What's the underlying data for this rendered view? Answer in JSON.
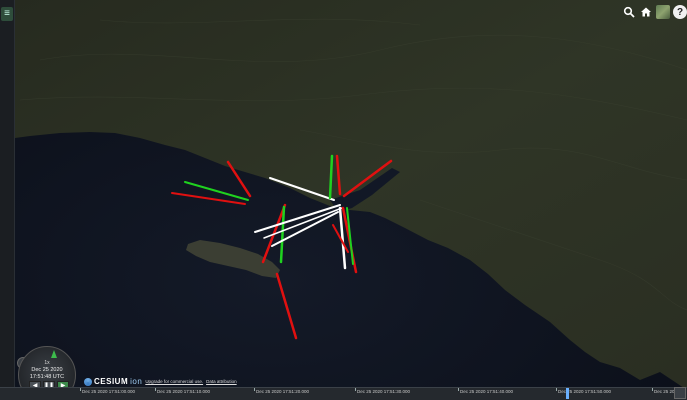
{
  "sidebar": {
    "menu_icon": "hamburger-icon",
    "menu_glyph": "≡"
  },
  "toolbar": {
    "search_icon": "search-icon",
    "home_icon": "home-icon",
    "layer_picker_icon": "imagery-layer-picker-icon",
    "help_label": "?"
  },
  "clock": {
    "speed": "1x",
    "date": "Dec 25 2020",
    "time": "17:51:48 UTC",
    "buttons": [
      "◀",
      "❚❚",
      "▶"
    ]
  },
  "credits": {
    "logo_text": "CESIUM",
    "logo_suffix": "ion",
    "upgrade_link": "Upgrade for commercial use.",
    "data_link": "Data attribution"
  },
  "timeline": {
    "ticks": [
      "Dec 25 2020 17:51:00.000",
      "Dec 25 2020 17:51:10.000",
      "Dec 25 2020 17:51:20.000",
      "Dec 25 2020 17:51:30.000",
      "Dec 25 2020 17:51:40.000",
      "Dec 25 2020 17:51:50.000",
      "Dec 25 2020"
    ]
  },
  "colors": {
    "land": "#2f3424",
    "water": "#101522",
    "track_green": "#1fd21f",
    "track_red": "#e01010",
    "track_white": "#ffffff"
  }
}
